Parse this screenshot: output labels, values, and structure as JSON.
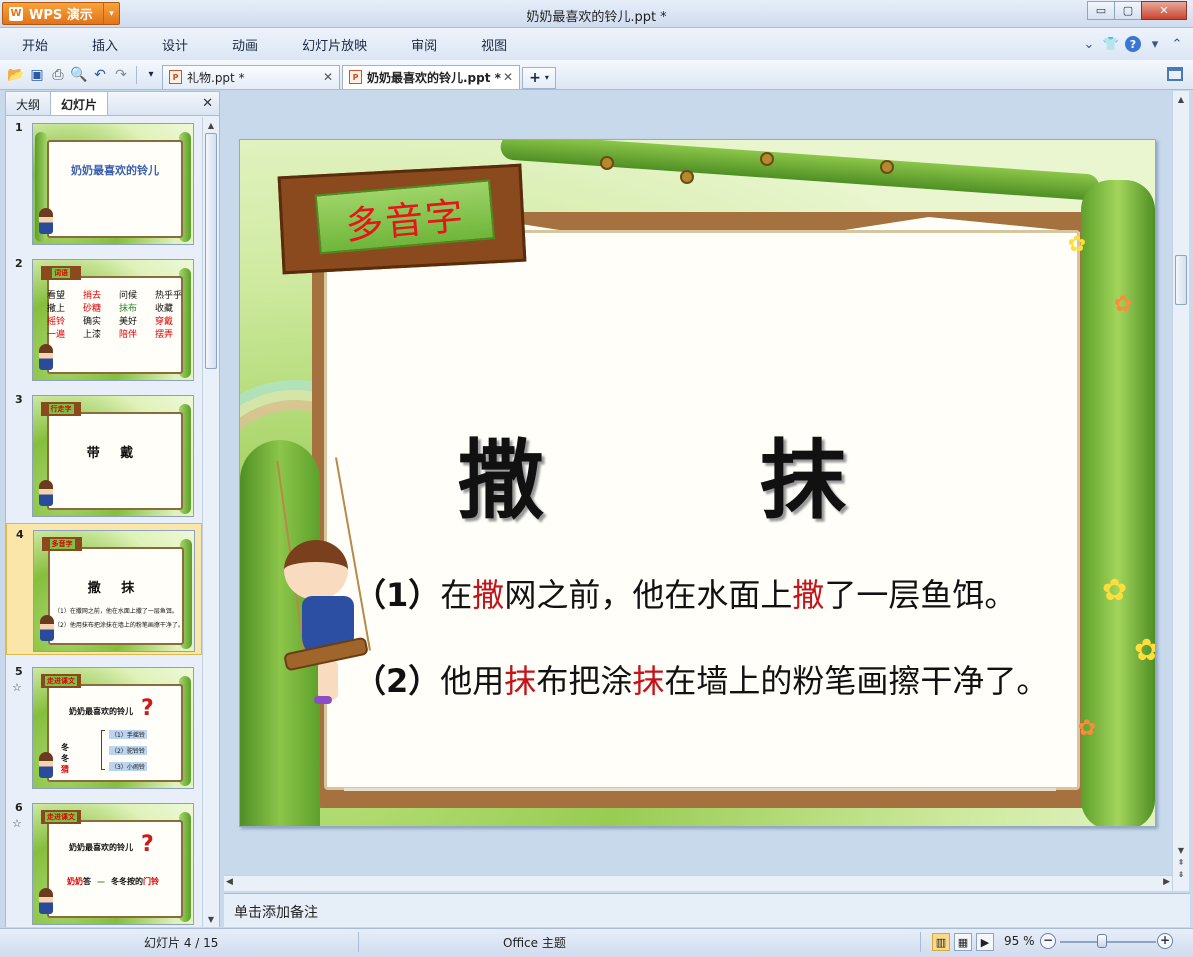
{
  "window": {
    "app_name": "WPS 演示",
    "title": "奶奶最喜欢的铃儿.ppt *",
    "controls": {
      "minimize": "▭",
      "maximize": "▢",
      "close": "✕"
    }
  },
  "menu": {
    "items": [
      "开始",
      "插入",
      "设计",
      "动画",
      "幻灯片放映",
      "审阅",
      "视图"
    ]
  },
  "toolbar": {
    "icons": [
      "open-icon",
      "save-icon",
      "print-icon",
      "print-preview-icon",
      "undo-icon",
      "redo-icon"
    ],
    "tabs": [
      {
        "label": "礼物.ppt *",
        "active": false
      },
      {
        "label": "奶奶最喜欢的铃儿.ppt *",
        "active": true
      }
    ],
    "new_tab_label": "+"
  },
  "left_panel": {
    "tabs": [
      {
        "label": "大纲",
        "active": false
      },
      {
        "label": "幻灯片",
        "active": true
      }
    ],
    "close_label": "✕",
    "thumbnails": [
      {
        "num": "1",
        "title": "奶奶最喜欢的铃儿"
      },
      {
        "num": "2",
        "sign": "词语",
        "words": [
          [
            "看望",
            "捎去",
            "问候",
            "热乎乎"
          ],
          [
            "撒上",
            "砂糖",
            "抹布",
            "收藏"
          ],
          [
            "摇铃",
            "确实",
            "美好",
            "穿戴"
          ],
          [
            "一遍",
            "上漆",
            "陪伴",
            "摆弄"
          ]
        ]
      },
      {
        "num": "3",
        "sign": "行走字",
        "chars": "带  戴"
      },
      {
        "num": "4",
        "sign": "多音字",
        "chars": "撒  抹",
        "line1": "（1）在撒网之前，他在水面上撒了一层鱼饵。",
        "line2": "（2）他用抹布把涂抹在墙上的粉笔画擦干净了。"
      },
      {
        "num": "5",
        "star": "☆",
        "sign": "走进课文",
        "question": "奶奶最喜欢的铃儿",
        "name_prefix": "冬冬",
        "name_hl": "猜",
        "options": [
          "（1）手摇铃",
          "（2）驼铃铃",
          "（3）小闹铃"
        ]
      },
      {
        "num": "6",
        "star": "☆",
        "sign": "走进课文",
        "question": "奶奶最喜欢的铃儿",
        "answer_prefix": "奶奶",
        "answer_hl": "答",
        "answer_text_a": "冬冬按的",
        "answer_text_b": "门铃",
        "dash": "—"
      }
    ]
  },
  "slide": {
    "sign": "多音字",
    "char1": "撒",
    "char2": "抹",
    "sentence1": {
      "num": "（1）",
      "a": "在",
      "b": "撒",
      "c": "网之前，他在水面上",
      "d": "撒",
      "e": "了一层鱼饵。"
    },
    "sentence2": {
      "num": "（2）",
      "a": "他用",
      "b": "抹",
      "c": "布把涂",
      "d": "抹",
      "e": "在墙上的粉笔画擦干净了。"
    }
  },
  "notes": {
    "placeholder": "单击添加备注"
  },
  "status": {
    "slide_info": "幻灯片 4 / 15",
    "theme": "Office 主题",
    "zoom": "95 %",
    "zoom_fraction": 0.5
  },
  "colors": {
    "accent_orange": "#e2731a",
    "highlight_red": "#c4141a",
    "selected_thumb": "#fbe6a9"
  }
}
